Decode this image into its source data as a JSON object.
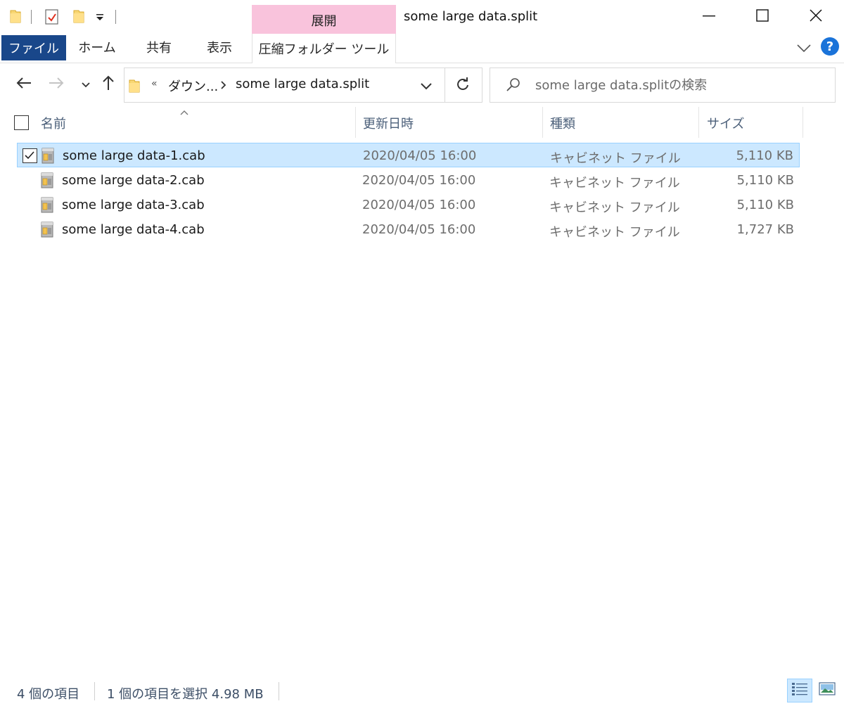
{
  "window": {
    "title": "some large data.split",
    "context_tab": "展開"
  },
  "ribbon": {
    "tabs": [
      {
        "label": "ファイル"
      },
      {
        "label": "ホーム"
      },
      {
        "label": "共有"
      },
      {
        "label": "表示"
      },
      {
        "label": "圧縮フォルダー ツール"
      }
    ],
    "help_label": "?"
  },
  "nav": {
    "overflow": "«",
    "breadcrumbs": [
      "ダウン...",
      "some large data.split"
    ],
    "search_placeholder": "some large data.splitの検索"
  },
  "columns": {
    "name": "名前",
    "date": "更新日時",
    "type": "種類",
    "size": "サイズ"
  },
  "files": [
    {
      "name": "some large data-1.cab",
      "date": "2020/04/05 16:00",
      "type": "キャビネット ファイル",
      "size": "5,110 KB",
      "selected": true
    },
    {
      "name": "some large data-2.cab",
      "date": "2020/04/05 16:00",
      "type": "キャビネット ファイル",
      "size": "5,110 KB",
      "selected": false
    },
    {
      "name": "some large data-3.cab",
      "date": "2020/04/05 16:00",
      "type": "キャビネット ファイル",
      "size": "5,110 KB",
      "selected": false
    },
    {
      "name": "some large data-4.cab",
      "date": "2020/04/05 16:00",
      "type": "キャビネット ファイル",
      "size": "1,727 KB",
      "selected": false
    }
  ],
  "status": {
    "item_count": "4 個の項目",
    "selection": "1 個の項目を選択  4.98 MB"
  },
  "colors": {
    "file_tab": "#19478a",
    "context_tab": "#f9c3dc",
    "selection": "#cce8ff",
    "selection_border": "#99d1ff",
    "help": "#1a73d9"
  },
  "icons": {
    "quick_access": [
      "folder-icon",
      "properties-icon",
      "new-folder-icon",
      "customize-dropdown-icon"
    ],
    "window_controls": [
      "minimize-icon",
      "maximize-icon",
      "close-icon"
    ],
    "nav": [
      "back-arrow-icon",
      "forward-arrow-icon",
      "recent-dropdown-icon",
      "up-arrow-icon",
      "refresh-icon",
      "search-icon"
    ],
    "file": "cabinet-file-icon",
    "views": [
      "details-view-icon",
      "large-icons-view-icon"
    ]
  }
}
